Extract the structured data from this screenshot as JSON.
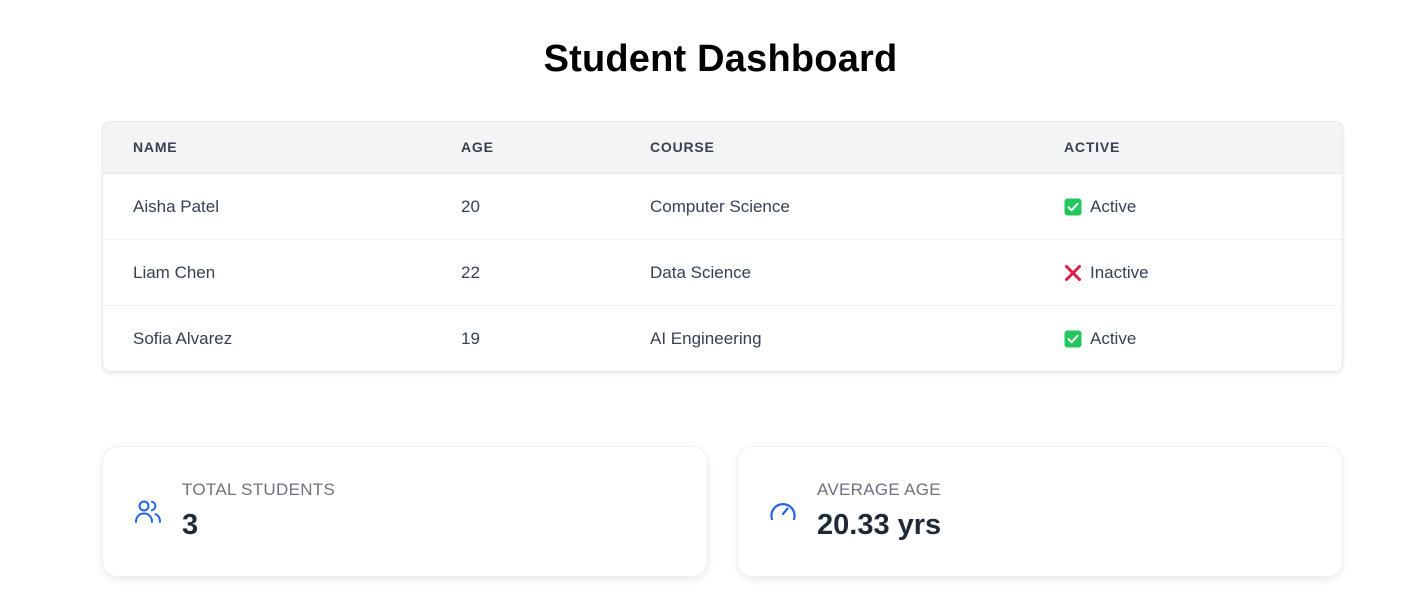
{
  "page": {
    "title": "Student Dashboard"
  },
  "table": {
    "headers": [
      "Name",
      "Age",
      "Course",
      "Active"
    ],
    "rows": [
      {
        "name": "Aisha Patel",
        "age": "20",
        "course": "Computer Science",
        "status": "Active",
        "status_icon": "check-square-icon"
      },
      {
        "name": "Liam Chen",
        "age": "22",
        "course": "Data Science",
        "status": "Inactive",
        "status_icon": "cross-icon"
      },
      {
        "name": "Sofia Alvarez",
        "age": "19",
        "course": "AI Engineering",
        "status": "Active",
        "status_icon": "check-square-icon"
      }
    ]
  },
  "stats": {
    "total": {
      "label": "Total Students",
      "value": "3",
      "icon": "users-icon"
    },
    "average": {
      "label": "Average Age",
      "value": "20.33 yrs",
      "icon": "gauge-icon"
    }
  },
  "colors": {
    "active": "#22c55e",
    "inactive": "#e11d48",
    "accent": "#2563eb"
  }
}
